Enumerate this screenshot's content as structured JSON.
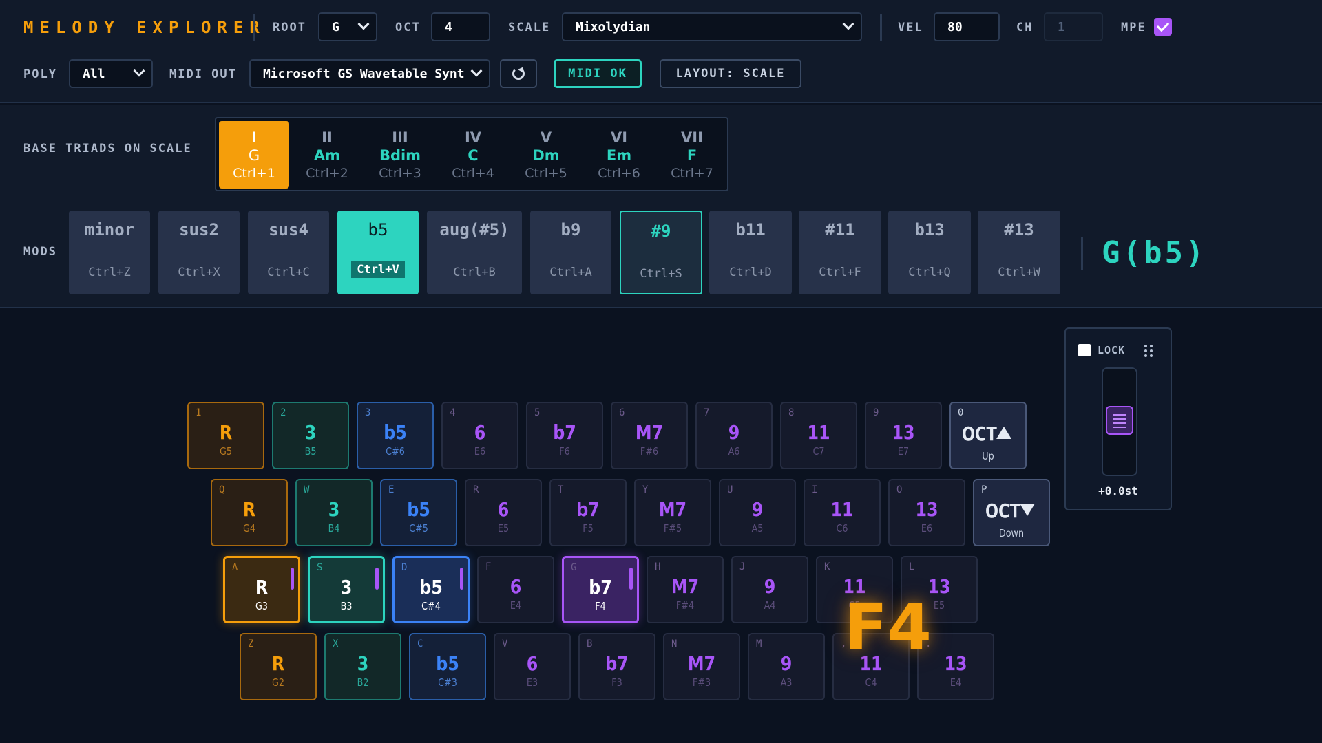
{
  "header": {
    "app_title": "MELODY EXPLORER",
    "root": {
      "label": "ROOT",
      "value": "G"
    },
    "oct": {
      "label": "OCT",
      "value": "4"
    },
    "scale": {
      "label": "SCALE",
      "value": "Mixolydian"
    },
    "vel": {
      "label": "VEL",
      "value": "80"
    },
    "ch": {
      "label": "CH",
      "value": "1"
    },
    "mpe": {
      "label": "MPE",
      "checked": true
    },
    "poly": {
      "label": "POLY",
      "value": "All"
    },
    "midi_out": {
      "label": "MIDI OUT",
      "value": "Microsoft GS Wavetable Synth"
    },
    "refresh_icon": "refresh-icon",
    "midi_status": "MIDI OK",
    "layout_button": "LAYOUT: SCALE"
  },
  "triads": {
    "label": "BASE TRIADS ON SCALE",
    "active_index": 0,
    "items": [
      {
        "degree": "I",
        "name": "G",
        "shortcut": "Ctrl+1"
      },
      {
        "degree": "II",
        "name": "Am",
        "shortcut": "Ctrl+2"
      },
      {
        "degree": "III",
        "name": "Bdim",
        "shortcut": "Ctrl+3"
      },
      {
        "degree": "IV",
        "name": "C",
        "shortcut": "Ctrl+4"
      },
      {
        "degree": "V",
        "name": "Dm",
        "shortcut": "Ctrl+5"
      },
      {
        "degree": "VI",
        "name": "Em",
        "shortcut": "Ctrl+6"
      },
      {
        "degree": "VII",
        "name": "F",
        "shortcut": "Ctrl+7"
      }
    ]
  },
  "mods": {
    "label": "MODS",
    "items": [
      {
        "name": "minor",
        "shortcut": "Ctrl+Z"
      },
      {
        "name": "sus2",
        "shortcut": "Ctrl+X"
      },
      {
        "name": "sus4",
        "shortcut": "Ctrl+C"
      },
      {
        "name": "b5",
        "shortcut": "Ctrl+V",
        "state": "selected"
      },
      {
        "name": "aug(#5)",
        "shortcut": "Ctrl+B"
      },
      {
        "name": "b9",
        "shortcut": "Ctrl+A"
      },
      {
        "name": "#9",
        "shortcut": "Ctrl+S",
        "state": "highlight"
      },
      {
        "name": "b11",
        "shortcut": "Ctrl+D"
      },
      {
        "name": "#11",
        "shortcut": "Ctrl+F"
      },
      {
        "name": "b13",
        "shortcut": "Ctrl+Q"
      },
      {
        "name": "#13",
        "shortcut": "Ctrl+W"
      }
    ],
    "current_chord": "G(b5)"
  },
  "keyboard": {
    "rows": [
      {
        "keys": [
          {
            "key": "1",
            "interval": "R",
            "note": "G5",
            "color": "r"
          },
          {
            "key": "2",
            "interval": "3",
            "note": "B5",
            "color": "t"
          },
          {
            "key": "3",
            "interval": "b5",
            "note": "C#6",
            "color": "b"
          },
          {
            "key": "4",
            "interval": "6",
            "note": "E6",
            "color": "p"
          },
          {
            "key": "5",
            "interval": "b7",
            "note": "F6",
            "color": "p"
          },
          {
            "key": "6",
            "interval": "M7",
            "note": "F#6",
            "color": "p"
          },
          {
            "key": "7",
            "interval": "9",
            "note": "A6",
            "color": "p"
          },
          {
            "key": "8",
            "interval": "11",
            "note": "C7",
            "color": "p"
          },
          {
            "key": "9",
            "interval": "13",
            "note": "E7",
            "color": "p"
          }
        ],
        "oct": {
          "key": "0",
          "text": "OCT",
          "label": "Up",
          "dir": "up"
        }
      },
      {
        "keys": [
          {
            "key": "Q",
            "interval": "R",
            "note": "G4",
            "color": "r"
          },
          {
            "key": "W",
            "interval": "3",
            "note": "B4",
            "color": "t"
          },
          {
            "key": "E",
            "interval": "b5",
            "note": "C#5",
            "color": "b"
          },
          {
            "key": "R",
            "interval": "6",
            "note": "E5",
            "color": "p"
          },
          {
            "key": "T",
            "interval": "b7",
            "note": "F5",
            "color": "p"
          },
          {
            "key": "Y",
            "interval": "M7",
            "note": "F#5",
            "color": "p"
          },
          {
            "key": "U",
            "interval": "9",
            "note": "A5",
            "color": "p"
          },
          {
            "key": "I",
            "interval": "11",
            "note": "C6",
            "color": "p"
          },
          {
            "key": "O",
            "interval": "13",
            "note": "E6",
            "color": "p"
          }
        ],
        "oct": {
          "key": "P",
          "text": "OCT",
          "label": "Down",
          "dir": "down"
        }
      },
      {
        "keys": [
          {
            "key": "A",
            "interval": "R",
            "note": "G3",
            "color": "r",
            "on": true
          },
          {
            "key": "S",
            "interval": "3",
            "note": "B3",
            "color": "t",
            "on": true
          },
          {
            "key": "D",
            "interval": "b5",
            "note": "C#4",
            "color": "b",
            "on": true
          },
          {
            "key": "F",
            "interval": "6",
            "note": "E4",
            "color": "p"
          },
          {
            "key": "G",
            "interval": "b7",
            "note": "F4",
            "color": "p",
            "on": true
          },
          {
            "key": "H",
            "interval": "M7",
            "note": "F#4",
            "color": "p"
          },
          {
            "key": "J",
            "interval": "9",
            "note": "A4",
            "color": "p"
          },
          {
            "key": "K",
            "interval": "11",
            "note": "C5",
            "color": "p"
          },
          {
            "key": "L",
            "interval": "13",
            "note": "E5",
            "color": "p"
          }
        ]
      },
      {
        "keys": [
          {
            "key": "Z",
            "interval": "R",
            "note": "G2",
            "color": "r"
          },
          {
            "key": "X",
            "interval": "3",
            "note": "B2",
            "color": "t"
          },
          {
            "key": "C",
            "interval": "b5",
            "note": "C#3",
            "color": "b"
          },
          {
            "key": "V",
            "interval": "6",
            "note": "E3",
            "color": "p"
          },
          {
            "key": "B",
            "interval": "b7",
            "note": "F3",
            "color": "p"
          },
          {
            "key": "N",
            "interval": "M7",
            "note": "F#3",
            "color": "p"
          },
          {
            "key": "M",
            "interval": "9",
            "note": "A3",
            "color": "p"
          },
          {
            "key": ",",
            "interval": "11",
            "note": "C4",
            "color": "p"
          },
          {
            "key": ".",
            "interval": "13",
            "note": "E4",
            "color": "p"
          }
        ]
      }
    ],
    "last_note": "F4"
  },
  "pitch_panel": {
    "lock_label": "LOCK",
    "lock_checked": false,
    "drag_icon": "drag-handle-icon",
    "bend_value": "+0.0st",
    "bend_fraction": 0.5
  },
  "colors": {
    "accent_orange": "#f59e0b",
    "accent_teal": "#2dd4bf",
    "accent_blue": "#3b82f6",
    "accent_purple": "#a855f7"
  }
}
